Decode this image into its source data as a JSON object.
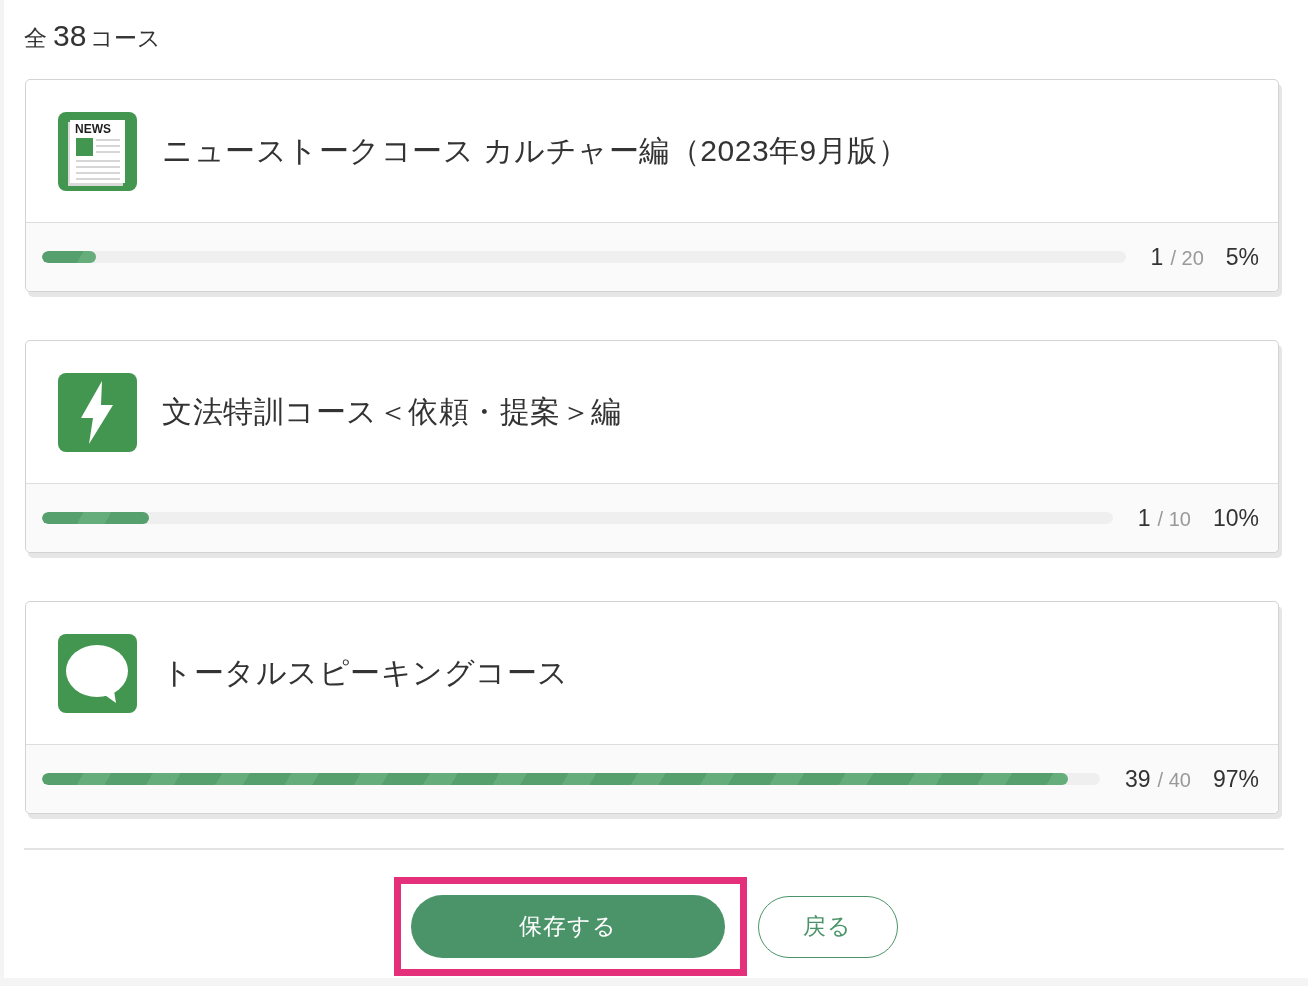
{
  "course_count": {
    "prefix": "全",
    "count": "38",
    "suffix": "コース"
  },
  "courses": [
    {
      "kind": "news",
      "icon_text": "NEWS",
      "title": "ニューストークコース カルチャー編（2023年9月版）",
      "done": "1",
      "total": "/ 20",
      "percent": "5%",
      "level": 0.05
    },
    {
      "kind": "lightning",
      "title": "文法特訓コース＜依頼・提案＞編",
      "done": "1",
      "total": "/ 10",
      "percent": "10%",
      "level": 0.1
    },
    {
      "kind": "speech",
      "title": "トータルスピーキングコース",
      "done": "39",
      "total": "/ 40",
      "percent": "97%",
      "level": 0.97
    }
  ],
  "save_button": {
    "label": "保存する",
    "highlighted": true
  },
  "back_button": {
    "label": "戻る"
  }
}
